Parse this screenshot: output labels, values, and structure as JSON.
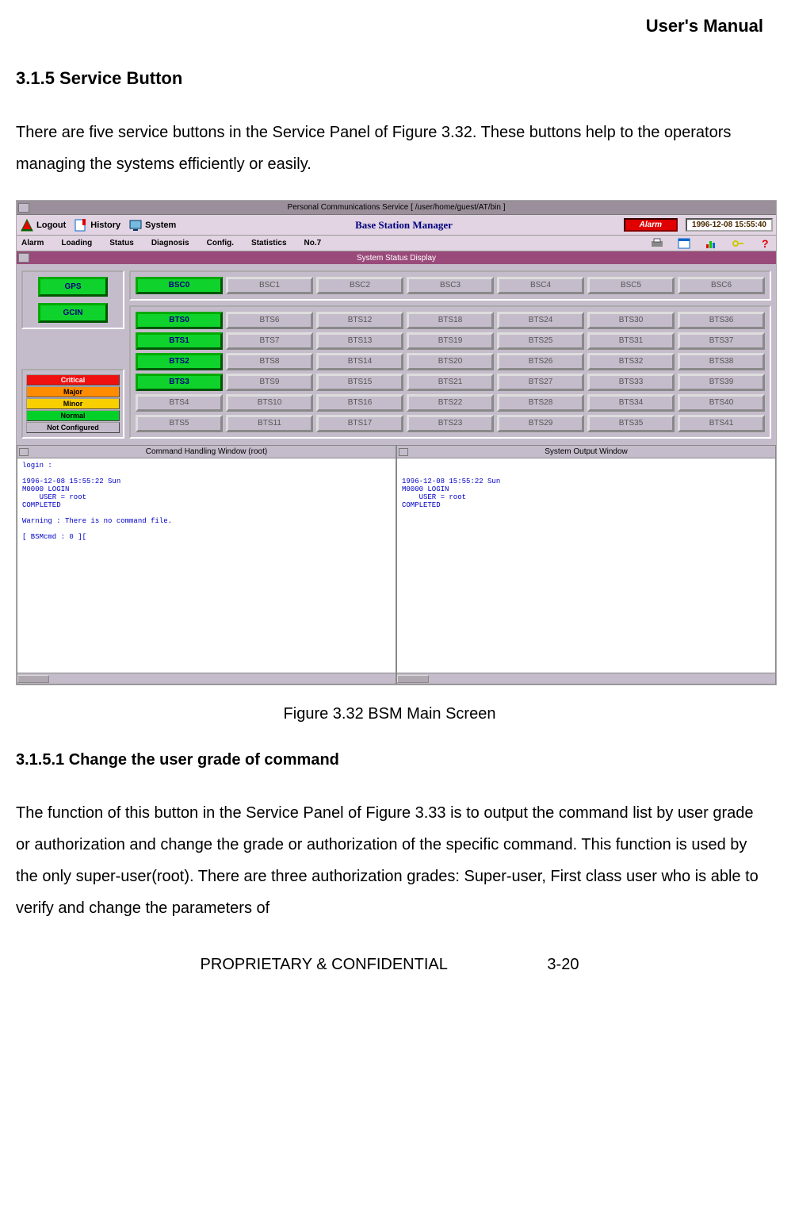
{
  "page": {
    "header": "User's Manual",
    "section_title": "3.1.5 Service Button",
    "para1": "There are five service buttons in the Service Panel of Figure 3.32. These buttons help to the operators managing the systems efficiently or easily.",
    "figure_caption": "Figure 3.32 BSM Main Screen",
    "subsection_title": "3.1.5.1 Change the user grade of command",
    "para2": "The function of this button in the Service Panel of Figure 3.33 is to output the command list by user grade or authorization and change the grade or authorization of the specific command. This function is used by the only super-user(root). There are three authorization grades: Super-user, First class user who is able to verify and change the parameters of",
    "footer_left": "PROPRIETARY & CONFIDENTIAL",
    "footer_right": "3-20"
  },
  "window": {
    "title": "Personal Communications Service [ /user/home/guest/AT/bin ]",
    "toolbar1": {
      "logout": "Logout",
      "history": "History",
      "system": "System",
      "brand": "Base Station Manager",
      "alarm": "Alarm",
      "datetime": "1996-12-08 15:55:40"
    },
    "menubar": [
      "Alarm",
      "Loading",
      "Status",
      "Diagnosis",
      "Config.",
      "Statistics",
      "No.7"
    ],
    "ssd_title": "System Status Display",
    "left_buttons": [
      "GPS",
      "GCIN"
    ],
    "legend": [
      {
        "label": "Critical",
        "cls": "legend-crit"
      },
      {
        "label": "Major",
        "cls": "legend-maj"
      },
      {
        "label": "Minor",
        "cls": "legend-min"
      },
      {
        "label": "Normal",
        "cls": "legend-norm"
      },
      {
        "label": "Not Configured",
        "cls": "legend-nc"
      }
    ],
    "bsc_row": [
      {
        "label": "BSC0",
        "active": true
      },
      {
        "label": "BSC1",
        "active": false
      },
      {
        "label": "BSC2",
        "active": false
      },
      {
        "label": "BSC3",
        "active": false
      },
      {
        "label": "BSC4",
        "active": false
      },
      {
        "label": "BSC5",
        "active": false
      },
      {
        "label": "BSC6",
        "active": false
      }
    ],
    "bts_grid": [
      {
        "label": "BTS0",
        "active": true
      },
      {
        "label": "BTS6"
      },
      {
        "label": "BTS12"
      },
      {
        "label": "BTS18"
      },
      {
        "label": "BTS24"
      },
      {
        "label": "BTS30"
      },
      {
        "label": "BTS36"
      },
      {
        "label": "BTS1",
        "active": true
      },
      {
        "label": "BTS7"
      },
      {
        "label": "BTS13"
      },
      {
        "label": "BTS19"
      },
      {
        "label": "BTS25"
      },
      {
        "label": "BTS31"
      },
      {
        "label": "BTS37"
      },
      {
        "label": "BTS2",
        "active": true
      },
      {
        "label": "BTS8"
      },
      {
        "label": "BTS14"
      },
      {
        "label": "BTS20"
      },
      {
        "label": "BTS26"
      },
      {
        "label": "BTS32"
      },
      {
        "label": "BTS38"
      },
      {
        "label": "BTS3",
        "active": true
      },
      {
        "label": "BTS9"
      },
      {
        "label": "BTS15"
      },
      {
        "label": "BTS21"
      },
      {
        "label": "BTS27"
      },
      {
        "label": "BTS33"
      },
      {
        "label": "BTS39"
      },
      {
        "label": "BTS4"
      },
      {
        "label": "BTS10"
      },
      {
        "label": "BTS16"
      },
      {
        "label": "BTS22"
      },
      {
        "label": "BTS28"
      },
      {
        "label": "BTS34"
      },
      {
        "label": "BTS40"
      },
      {
        "label": "BTS5"
      },
      {
        "label": "BTS11"
      },
      {
        "label": "BTS17"
      },
      {
        "label": "BTS23"
      },
      {
        "label": "BTS29"
      },
      {
        "label": "BTS35"
      },
      {
        "label": "BTS41"
      }
    ],
    "cmd_win_title": "Command Handling Window (root)",
    "out_win_title": "System Output Window",
    "cmd_text": "login :\n\n1996-12-08 15:55:22 Sun\nM0000 LOGIN\n    USER = root\nCOMPLETED\n\nWarning : There is no command file.\n\n[ BSMcmd : 0 ][",
    "out_text": "\n\n1996-12-08 15:55:22 Sun\nM0000 LOGIN\n    USER = root\nCOMPLETED"
  }
}
